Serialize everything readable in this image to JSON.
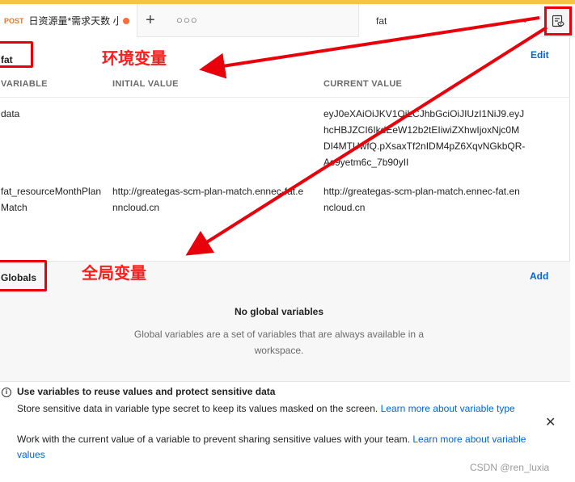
{
  "tab": {
    "method": "POST",
    "title": "日资源量*需求天数 小于"
  },
  "environment_selector": {
    "value": "fat"
  },
  "environment": {
    "name": "fat",
    "edit_label": "Edit",
    "columns": [
      "VARIABLE",
      "INITIAL VALUE",
      "CURRENT VALUE"
    ],
    "rows": [
      {
        "variable": "data",
        "initial_value": "",
        "current_value": "eyJ0eXAiOiJKV1QiLCJhbGciOiJIUzI1NiJ9.eyJhcHBJZCI6IkdEeW12b2tEIiwiZXhwIjoxNjc0MDI4MTUwfQ.pXsaxTf2nIDM4pZ6XqvNGkbQR-As9yetm6c_7b90yII"
      },
      {
        "variable": "fat_resourceMonthPlanMatch",
        "initial_value": "http://greategas-scm-plan-match.ennec-fat.enncloud.cn",
        "current_value": "http://greategas-scm-plan-match.ennec-fat.enncloud.cn"
      }
    ]
  },
  "globals": {
    "title": "Globals",
    "add_label": "Add",
    "empty_title": "No global variables",
    "empty_desc": "Global variables are a set of variables that are always available in a workspace."
  },
  "info": {
    "title": "Use variables to reuse values and protect sensitive data",
    "line1": "Store sensitive data in variable type secret to keep its values masked on the screen.",
    "line1_link": "Learn more about variable type",
    "line2": "Work with the current value of a variable to prevent sharing sensitive values with your team.",
    "line2_link": "Learn more about variable values"
  },
  "annotations": {
    "env_label": "环境变量",
    "globals_label": "全局变量"
  },
  "watermark": "CSDN @ren_luxia",
  "colors": {
    "accent": "#f5c542",
    "link": "#0265d2",
    "annotation_red": "#e8000b"
  }
}
